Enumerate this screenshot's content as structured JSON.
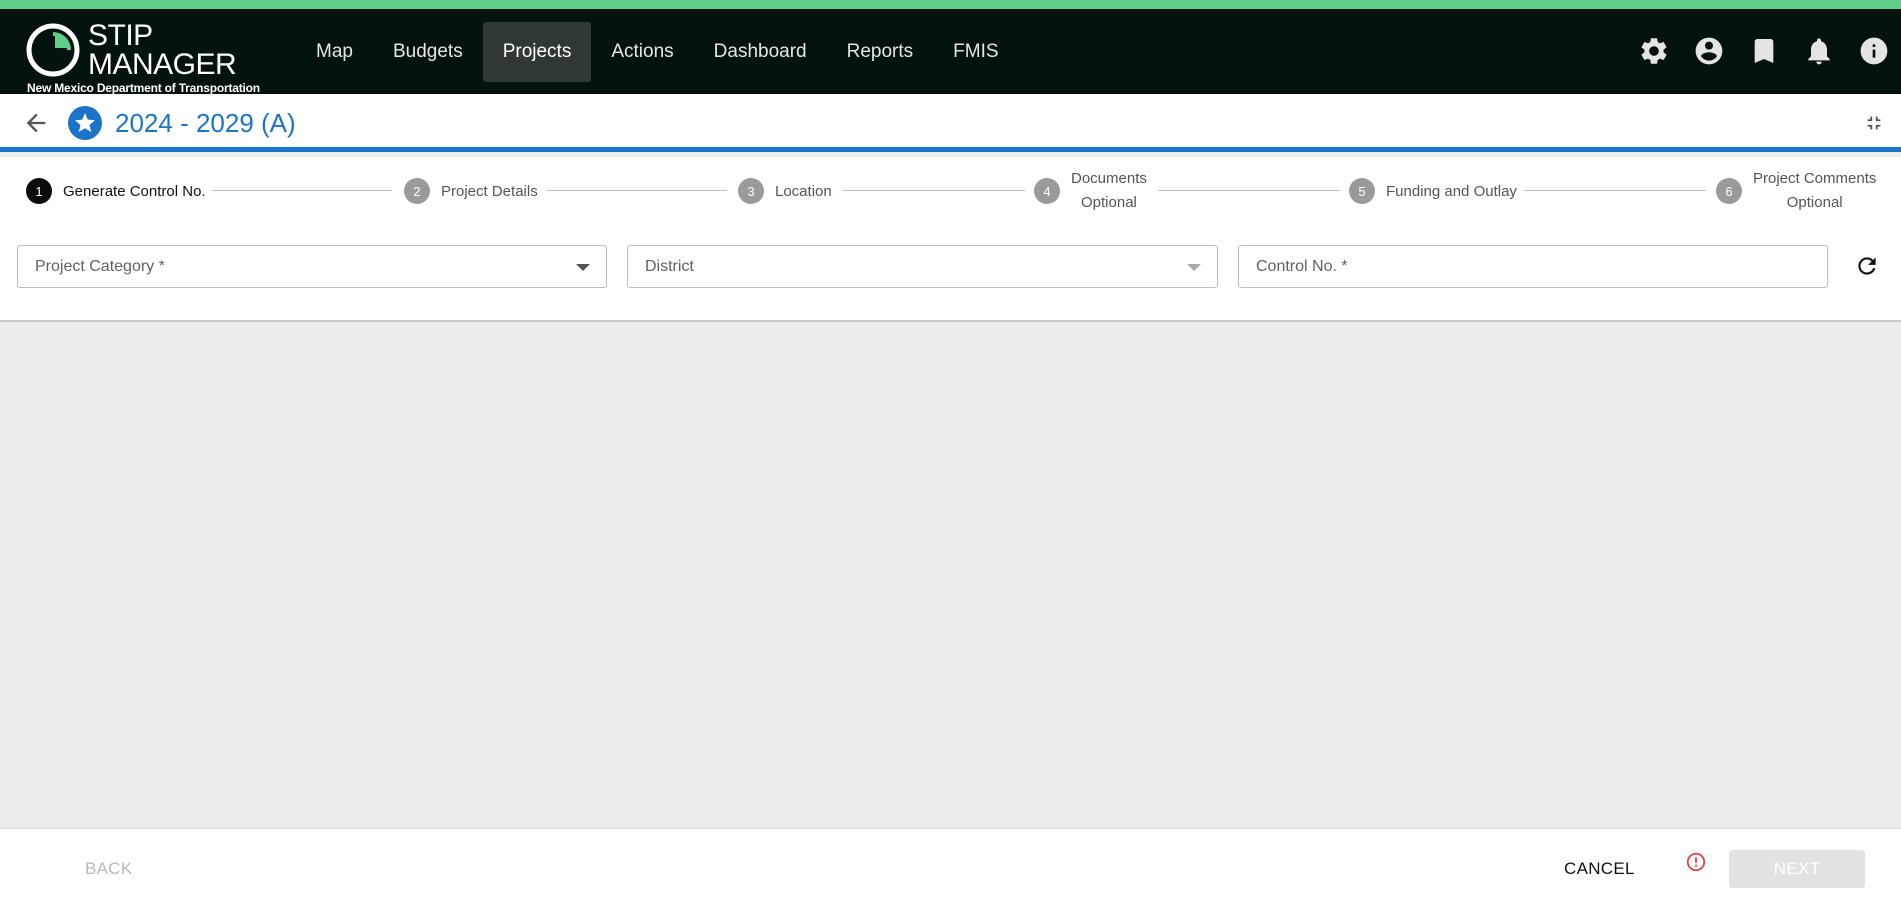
{
  "app": {
    "name": "STIP MANAGER",
    "name_line1": "STIP",
    "name_line2": "MANAGER",
    "subtitle": "New Mexico Department of Transportation",
    "colors": {
      "accent": "#1c74c9",
      "brand_green": "#5fd08a",
      "appbar": "#041210"
    }
  },
  "nav": {
    "items": [
      {
        "label": "Map"
      },
      {
        "label": "Budgets"
      },
      {
        "label": "Projects",
        "active": true
      },
      {
        "label": "Actions"
      },
      {
        "label": "Dashboard"
      },
      {
        "label": "Reports"
      },
      {
        "label": "FMIS"
      }
    ]
  },
  "toolbar": {
    "icons": [
      "gear-icon",
      "account-circle-icon",
      "bookmark-icon",
      "bell-icon",
      "info-icon"
    ]
  },
  "header": {
    "title": "2024 - 2029 (A)",
    "icons": [
      "back-arrow-icon",
      "star-icon",
      "collapse-icon"
    ]
  },
  "stepper": {
    "steps": [
      {
        "num": "1",
        "label": "Generate Control No.",
        "sub": "",
        "active": true
      },
      {
        "num": "2",
        "label": "Project Details",
        "sub": ""
      },
      {
        "num": "3",
        "label": "Location",
        "sub": ""
      },
      {
        "num": "4",
        "label": "Documents",
        "sub": "Optional"
      },
      {
        "num": "5",
        "label": "Funding and Outlay",
        "sub": ""
      },
      {
        "num": "6",
        "label": "Project Comments",
        "sub": "Optional"
      }
    ]
  },
  "form": {
    "project_category": {
      "placeholder": "Project Category *",
      "value": ""
    },
    "district": {
      "placeholder": "District",
      "value": ""
    },
    "control_no": {
      "placeholder": "Control No. *",
      "value": ""
    }
  },
  "footer": {
    "back_label": "BACK",
    "cancel_label": "CANCEL",
    "next_label": "NEXT"
  }
}
